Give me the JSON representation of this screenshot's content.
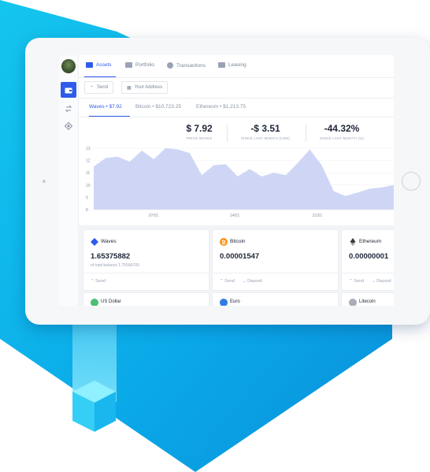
{
  "colors": {
    "accent": "#2f5bea",
    "chart_fill": "#cfd6f5",
    "background_blue": "#0aa3e6"
  },
  "nav": {
    "tabs": [
      {
        "label": "Assets",
        "icon": "wallet-icon"
      },
      {
        "label": "Portfolio",
        "icon": "portfolio-icon"
      },
      {
        "label": "Transactions",
        "icon": "transactions-icon"
      },
      {
        "label": "Leasing",
        "icon": "leasing-icon"
      }
    ]
  },
  "actions": {
    "send": "Send",
    "address": "Your Address"
  },
  "asset_tabs": [
    {
      "name": "Waves",
      "price": "$7.92"
    },
    {
      "name": "Bitcoin",
      "price": "$10,723.25"
    },
    {
      "name": "Ethereum",
      "price": "$1,213.75"
    }
  ],
  "stats": [
    {
      "value": "$ 7.92",
      "label": "PRICE WAVES"
    },
    {
      "value": "-$ 3.51",
      "label": "SINCE LAST MONTH (USD)"
    },
    {
      "value": "-44.32%",
      "label": "SINCE LAST MONTH (%)"
    }
  ],
  "chart_data": {
    "type": "area",
    "y_ticks": [
      13,
      12,
      11,
      10,
      9,
      8
    ],
    "ylim": [
      8,
      13
    ],
    "x_labels": [
      "07/01",
      "14/01",
      "21/01"
    ],
    "values": [
      11.5,
      12.2,
      12.3,
      11.9,
      12.8,
      12.1,
      13.0,
      12.9,
      12.6,
      10.8,
      11.6,
      11.7,
      10.7,
      11.3,
      10.7,
      11.0,
      10.8,
      11.8,
      12.9,
      11.6,
      9.5,
      9.1,
      9.4,
      9.7,
      9.8,
      10.0
    ],
    "grid": true,
    "legend": "none"
  },
  "cards": [
    {
      "name": "Waves",
      "balance": "1.65375882",
      "sub": "of total balance 1.75566700",
      "actions": [
        "Send"
      ]
    },
    {
      "name": "Bitcoin",
      "balance": "0.00001547",
      "sub": "",
      "actions": [
        "Send",
        "Deposit"
      ]
    },
    {
      "name": "Ethereum",
      "balance": "0.00000001",
      "sub": "",
      "actions": [
        "Send",
        "Deposit"
      ]
    }
  ],
  "cards_row2": [
    {
      "name": "US Dollar"
    },
    {
      "name": "Euro"
    },
    {
      "name": "Litecoin"
    }
  ]
}
